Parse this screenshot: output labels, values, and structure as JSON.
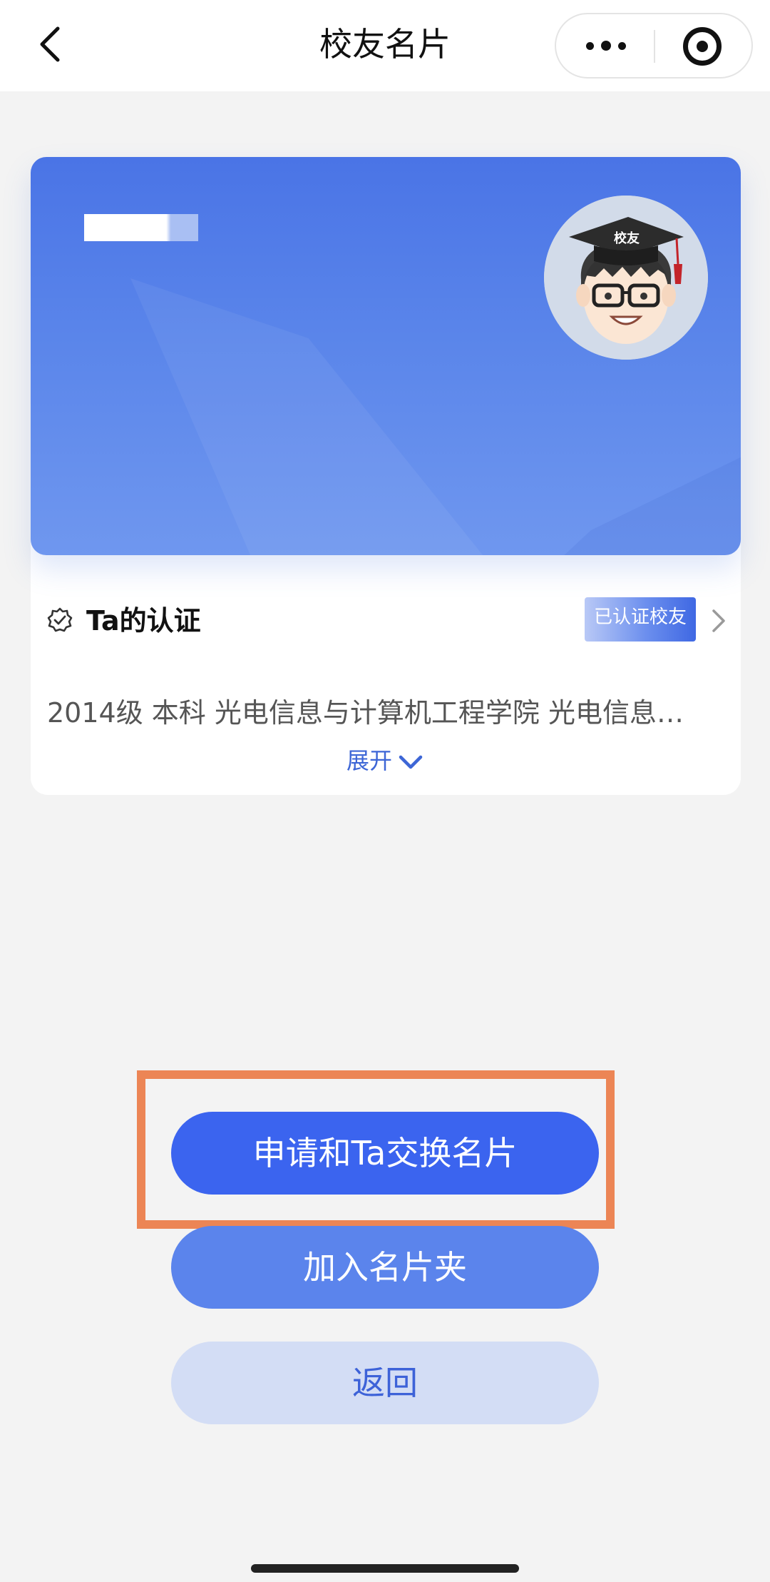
{
  "navbar": {
    "title": "校友名片",
    "back_icon": "chevron-left-icon",
    "more_icon": "more-dots-icon",
    "close_icon": "target-circle-icon"
  },
  "card": {
    "avatar_icon": "graduate-avatar",
    "avatar_cap_text": "校友",
    "certification": {
      "icon": "verified-badge-icon",
      "title": "Ta的认证",
      "badge": "已认证校友",
      "arrow_icon": "chevron-right-icon"
    },
    "info": "2014级 本科 光电信息与计算机工程学院 光电信息…",
    "expand_label": "展开",
    "expand_icon": "chevron-down-icon"
  },
  "actions": {
    "exchange": "申请和Ta交换名片",
    "add_to_holder": "加入名片夹",
    "back": "返回"
  },
  "colors": {
    "primary": "#3b64ef",
    "secondary": "#5b84ec",
    "light": "#d3ddf5",
    "highlight": "#ec8555",
    "banner": "#4a74e6"
  }
}
